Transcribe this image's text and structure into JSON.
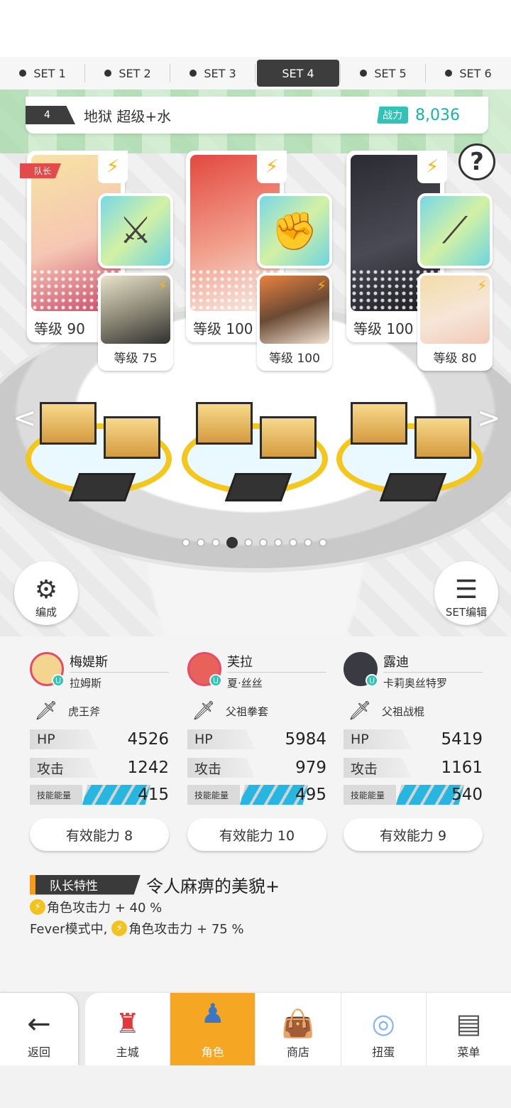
{
  "set_tabs": [
    "SET 1",
    "SET 2",
    "SET 3",
    "SET 4",
    "SET 5",
    "SET 6"
  ],
  "active_set": "SET 4",
  "team": {
    "number": "4",
    "name": "地狱 超级+水",
    "power_label": "战力",
    "power_value": "8,036"
  },
  "help_icon": "?",
  "leader_tag": "队长",
  "cards": [
    {
      "level": "等级 90",
      "sub_level": "等级 75",
      "weapon_icon": "axe-icon",
      "art_color": "#f6c7b3"
    },
    {
      "level": "等级 100",
      "sub_level": "等级 100",
      "weapon_icon": "gauntlet-icon",
      "art_color": "#f2a08d"
    },
    {
      "level": "等级 100",
      "sub_level": "等级 80",
      "weapon_icon": "staff-icon",
      "art_color": "#4a4a55"
    }
  ],
  "pager": {
    "count": 10,
    "active_index": 3
  },
  "buttons": {
    "formation": "编成",
    "set_edit": "SET编辑"
  },
  "members": [
    {
      "name": "梅媞斯",
      "sub_name": "拉姆斯",
      "weapon": "虎王斧",
      "hp_label": "HP",
      "hp": "4526",
      "atk_label": "攻击",
      "atk": "1242",
      "energy_label": "技能能量",
      "energy": "415",
      "effective": "有效能力 8",
      "avatar_color": "#f3d58f"
    },
    {
      "name": "芙拉",
      "sub_name": "夏·丝丝",
      "weapon": "父祖拳套",
      "hp_label": "HP",
      "hp": "5984",
      "atk_label": "攻击",
      "atk": "979",
      "energy_label": "技能能量",
      "energy": "495",
      "effective": "有效能力 10",
      "avatar_color": "#e8615a"
    },
    {
      "name": "露迪",
      "sub_name": "卡莉奥丝特罗",
      "weapon": "父祖战棍",
      "hp_label": "HP",
      "hp": "5419",
      "atk_label": "攻击",
      "atk": "1161",
      "energy_label": "技能能量",
      "energy": "540",
      "effective": "有效能力 9",
      "avatar_color": "#3a3a42"
    }
  ],
  "leader_skill": {
    "tag": "队长特性",
    "name": "令人麻痹的美貌+",
    "line1": "角色攻击力 + 40 %",
    "line2_prefix": "Fever模式中,",
    "line2": "角色攻击力 + 75 %"
  },
  "nav": {
    "back": "返回",
    "items": [
      "主城",
      "角色",
      "商店",
      "扭蛋",
      "菜单"
    ],
    "active": "角色"
  },
  "colors": {
    "accent": "#f5a623",
    "teal": "#33c3b6",
    "energy": "#26b6e0",
    "leader": "#e34a4a"
  }
}
